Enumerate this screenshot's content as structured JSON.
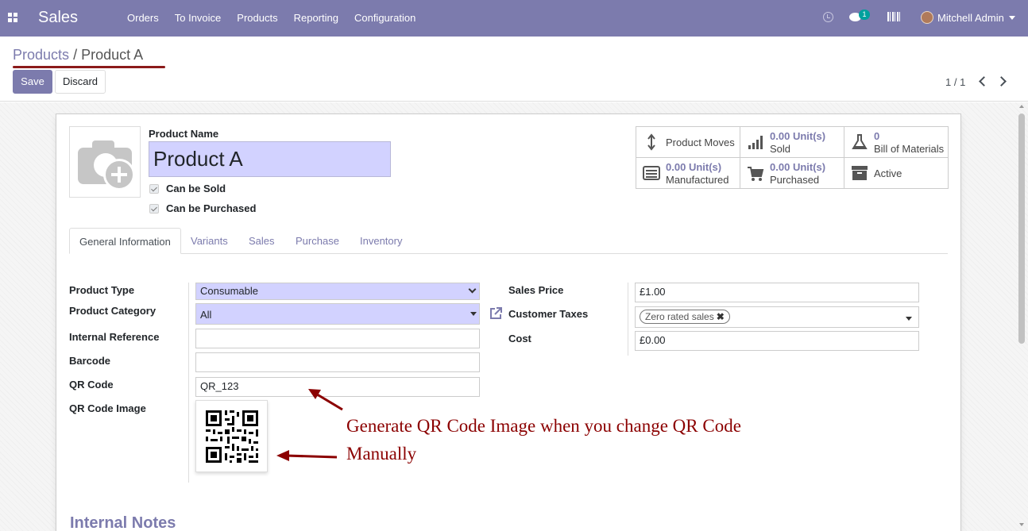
{
  "navbar": {
    "app_name": "Sales",
    "menu": [
      "Orders",
      "To Invoice",
      "Products",
      "Reporting",
      "Configuration"
    ],
    "chat_count": "1",
    "user": "Mitchell Admin",
    "icons": [
      "apps-icon",
      "clock-icon",
      "chat-icon",
      "barcode-icon",
      "avatar"
    ],
    "color": "#7c7bad"
  },
  "control": {
    "breadcrumb_root": "Products",
    "breadcrumb_sep": "/",
    "breadcrumb_current": "Product A",
    "save_label": "Save",
    "discard_label": "Discard",
    "pager": "1 / 1"
  },
  "product": {
    "name_label": "Product Name",
    "name": "Product A",
    "can_be_sold": "Can be Sold",
    "can_be_purchased": "Can be Purchased"
  },
  "smart_buttons": {
    "moves": "Product Moves",
    "sold_value": "0.00",
    "sold_unit": "Unit(s)",
    "sold_label": "Sold",
    "bom_value": "0",
    "bom_label": "Bill of Materials",
    "mfg_value": "0.00",
    "mfg_unit": "Unit(s)",
    "mfg_label": "Manufactured",
    "pur_value": "0.00",
    "pur_unit": "Unit(s)",
    "pur_label": "Purchased",
    "active_label": "Active"
  },
  "tabs": [
    "General Information",
    "Variants",
    "Sales",
    "Purchase",
    "Inventory"
  ],
  "fields": {
    "product_type_label": "Product Type",
    "product_type": "Consumable",
    "product_category_label": "Product Category",
    "product_category": "All",
    "internal_ref_label": "Internal Reference",
    "internal_ref": "",
    "barcode_label": "Barcode",
    "barcode": "",
    "qr_code_label": "QR Code",
    "qr_code": "QR_123",
    "qr_image_label": "QR Code Image",
    "sales_price_label": "Sales Price",
    "sales_price": "£1.00",
    "customer_taxes_label": "Customer Taxes",
    "customer_tax_tag": "Zero rated sales",
    "cost_label": "Cost",
    "cost": "£0.00"
  },
  "annotation": {
    "line1": "Generate QR Code Image when you change QR Code",
    "line2": "Manually",
    "color": "#8b0000"
  },
  "notes_title": "Internal Notes"
}
